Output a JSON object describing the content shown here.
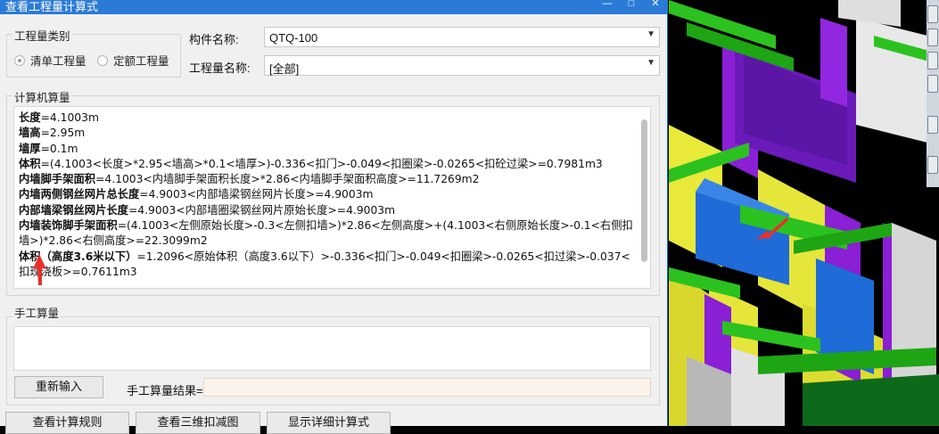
{
  "window": {
    "title": "查看工程量计算式",
    "controls": [
      "—",
      "□",
      "✕"
    ]
  },
  "category": {
    "label": "工程量类别",
    "options": [
      "清单工程量",
      "定额工程量"
    ],
    "selected": "清单工程量"
  },
  "component": {
    "label": "构件名称:",
    "value": "QTQ-100"
  },
  "quantity": {
    "label": "工程量名称:",
    "value": "[全部]"
  },
  "computer_calc": {
    "label": "计算机算量",
    "lines": [
      {
        "name": "长度",
        "expr": "=4.1003m"
      },
      {
        "name": "墙高",
        "expr": "=2.95m"
      },
      {
        "name": "墙厚",
        "expr": "=0.1m"
      },
      {
        "name": "体积",
        "expr": "=(4.1003<长度>*2.95<墙高>*0.1<墙厚>)-0.336<扣门>-0.049<扣圈梁>-0.0265<扣砼过梁>=0.7981m3"
      },
      {
        "name": "内墙脚手架面积",
        "expr": "=4.1003<内墙脚手架面积长度>*2.86<内墙脚手架面积高度>=11.7269m2"
      },
      {
        "name": "内墙两侧钢丝网片总长度",
        "expr": "=4.9003<内部墙梁钢丝网片长度>=4.9003m"
      },
      {
        "name": "内部墙梁钢丝网片长度",
        "expr": "=4.9003<内部墙圈梁钢丝网片原始长度>=4.9003m"
      },
      {
        "name": "内墙装饰脚手架面积",
        "expr": "=(4.1003<左侧原始长度>-0.3<左侧扣墙>)*2.86<左侧高度>+(4.1003<右侧原始长度>-0.1<右侧扣墙>)*2.86<右侧高度>=22.3099m2"
      },
      {
        "name": "体积（高度3.6米以下）",
        "expr": "=1.2096<原始体积（高度3.6以下）>-0.336<扣门>-0.049<扣圈梁>-0.0265<扣过梁>-0.037<扣现浇板>=0.7611m3"
      }
    ]
  },
  "manual_calc": {
    "label": "手工算量",
    "reinput_button": "重新输入",
    "result_label": "手工算量结果="
  },
  "bottom_buttons": [
    "查看计算规则",
    "查看三维扣减图",
    "显示详细计算式"
  ],
  "annotation_color": "#e8302a"
}
